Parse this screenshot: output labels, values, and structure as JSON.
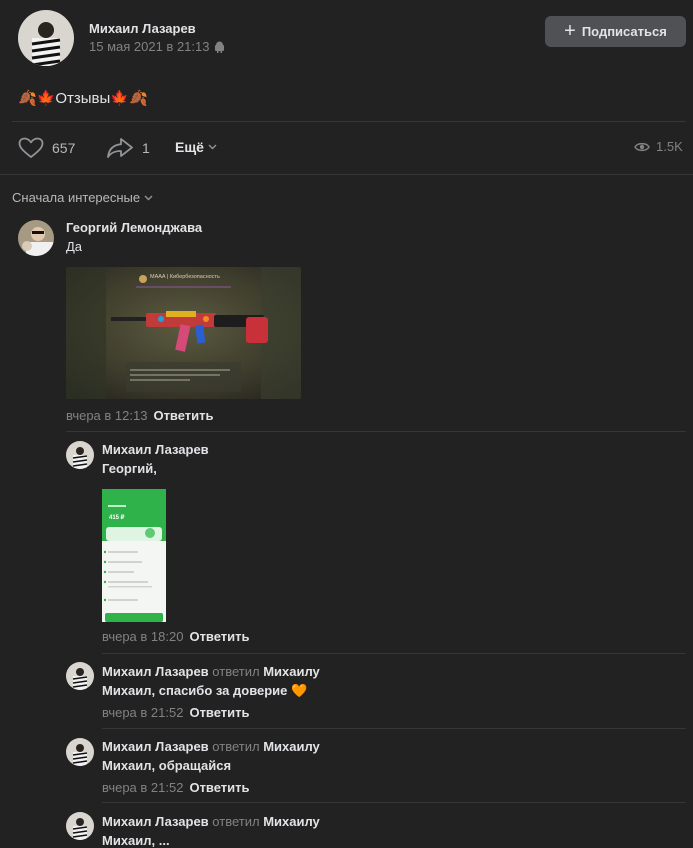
{
  "post": {
    "author": "Михаил Лазарев",
    "date": "15 мая 2021 в 21:13",
    "subscribe_label": "Подписаться",
    "text": "🍂🍁Отзывы🍁🍂",
    "likes": "657",
    "shares": "1",
    "more_label": "Ещё",
    "views": "1.5K"
  },
  "comments": {
    "sort_label": "Сначала интересные",
    "reply_label": "Ответить",
    "items": [
      {
        "author": "Георгий Лемонджава",
        "text": "Да",
        "time": "вчера в 12:13",
        "image_header": "MAAA | Кибербезопасность"
      },
      {
        "author": "Михаил Лазарев",
        "text": "Георгий,",
        "time": "вчера в 18:20",
        "image_amount": "415 ₽"
      },
      {
        "author": "Михаил Лазарев",
        "replied_word": "ответил",
        "replied_to": "Михаилу",
        "text": "Михаил, спасибо за доверие 🧡",
        "time": "вчера в 21:52"
      },
      {
        "author": "Михаил Лазарев",
        "replied_word": "ответил",
        "replied_to": "Михаилу",
        "text": "Михаил, обращайся",
        "time": "вчера в 21:52"
      },
      {
        "author": "Михаил Лазарев",
        "replied_word": "ответил",
        "replied_to": "Михаилу",
        "text": "Михаил, ..."
      }
    ]
  },
  "colors": {
    "background": "#222222",
    "text": "#e1e3e6",
    "muted": "#828282",
    "button": "#4f5154"
  }
}
